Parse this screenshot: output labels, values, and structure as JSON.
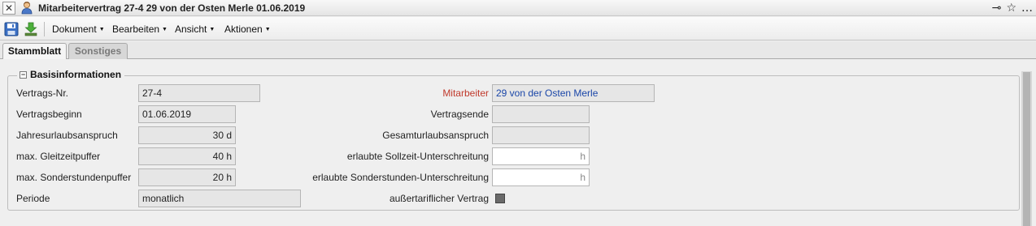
{
  "window": {
    "title": "Mitarbeitervertrag 27-4 29 von der Osten Merle 01.06.2019",
    "close_glyph": "✕",
    "pin_glyph": "⊸",
    "star_glyph": "☆",
    "more_glyph": "…"
  },
  "toolbar": {
    "icons": [
      "save-icon",
      "download-icon"
    ],
    "menus": [
      "Dokument",
      "Bearbeiten",
      "Ansicht",
      "Aktionen"
    ],
    "caret": "▼"
  },
  "tabs": [
    {
      "label": "Stammblatt",
      "active": true
    },
    {
      "label": "Sonstiges",
      "active": false
    }
  ],
  "section": {
    "title": "Basisinformationen",
    "toggle_glyph": "−"
  },
  "fields_left": {
    "vertragsnr": {
      "label": "Vertrags-Nr.",
      "value": "27-4"
    },
    "vertragsbeginn": {
      "label": "Vertragsbeginn",
      "value": "01.06.2019"
    },
    "jahresurlaub": {
      "label": "Jahresurlaubsanspruch",
      "value": "30 d"
    },
    "gleitzeit": {
      "label": "max. Gleitzeitpuffer",
      "value": "40 h"
    },
    "sonderstunden": {
      "label": "max. Sonderstundenpuffer",
      "value": "20 h"
    },
    "periode": {
      "label": "Periode",
      "value": "monatlich"
    }
  },
  "fields_right": {
    "mitarbeiter": {
      "label": "Mitarbeiter",
      "value": "29 von der Osten Merle"
    },
    "vertragsende": {
      "label": "Vertragsende",
      "value": ""
    },
    "gesamturlaub": {
      "label": "Gesamturlaubsanspruch",
      "value": ""
    },
    "sollzeit": {
      "label": "erlaubte Sollzeit-Unterschreitung",
      "value": "h"
    },
    "sonderstunden_unter": {
      "label": "erlaubte Sonderstunden-Unterschreitung",
      "value": "h"
    },
    "aussertariflich": {
      "label": "außertariflicher Vertrag",
      "checked": true
    }
  },
  "colors": {
    "required_label": "#c0392b",
    "link_value": "#1a46a8"
  }
}
